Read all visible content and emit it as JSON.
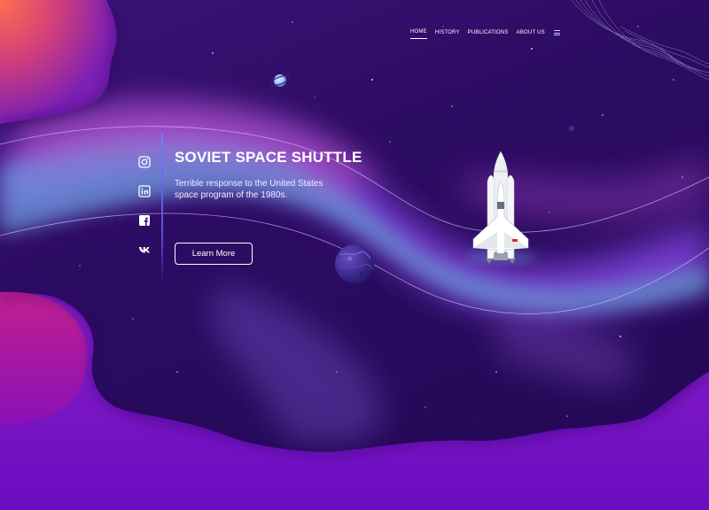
{
  "nav": {
    "items": [
      {
        "label": "HOME",
        "active": true
      },
      {
        "label": "HISTORY",
        "active": false
      },
      {
        "label": "PUBLICATIONS",
        "active": false
      },
      {
        "label": "ABOUT US",
        "active": false
      }
    ],
    "menu_icon": "hamburger-menu-icon"
  },
  "socials": [
    {
      "icon": "instagram-icon"
    },
    {
      "icon": "linkedin-icon"
    },
    {
      "icon": "facebook-icon"
    },
    {
      "icon": "vk-icon"
    }
  ],
  "hero": {
    "title": "SOVIET SPACE SHUTTLE",
    "description": "Terrible response to the United States space program of the 1980s.",
    "cta_label": "Learn More"
  },
  "colors": {
    "background_purple": "#6a0fc2",
    "space_dark": "#2a0a5e",
    "nebula_pink": "#d05ac8",
    "nebula_blue": "#6fd0f0",
    "accent_line": "#6c83ff",
    "text": "#ffffff"
  }
}
